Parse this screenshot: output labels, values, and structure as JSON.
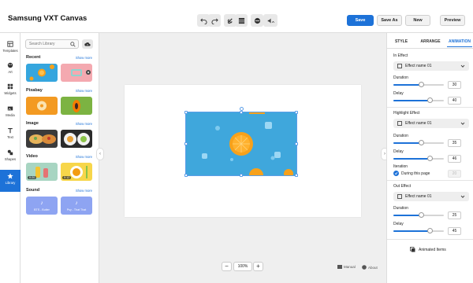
{
  "app": {
    "title": "Samsung VXT Canvas"
  },
  "toolbar": {
    "save": "Save",
    "save_as": "Save As",
    "new": "New",
    "preview": "Preview",
    "icons": [
      "undo-icon",
      "redo-icon",
      "link-icon",
      "grid-icon",
      "layers-icon",
      "volume-icon"
    ]
  },
  "nav": {
    "items": [
      {
        "label": "Templates",
        "icon": "templates-icon"
      },
      {
        "label": "Art",
        "icon": "art-icon"
      },
      {
        "label": "Widgets",
        "icon": "widgets-icon"
      },
      {
        "label": "Media",
        "icon": "media-icon"
      },
      {
        "label": "Text",
        "icon": "text-icon"
      },
      {
        "label": "Shapes",
        "icon": "shapes-icon"
      },
      {
        "label": "Library",
        "icon": "star-icon",
        "active": true
      }
    ]
  },
  "library": {
    "search_placeholder": "Search Library",
    "show_more": "Show more",
    "sections": {
      "recent": "Recent",
      "pixabay": "Pixabay",
      "image": "Image",
      "video": "Video",
      "sound": "Sound"
    },
    "video_badges": [
      "0:20",
      "0:12"
    ],
    "sounds": [
      "BTS - Butter",
      "Psy - That That"
    ]
  },
  "zoom": {
    "value": "100%",
    "minus": "−",
    "plus": "+"
  },
  "footer": {
    "manual": "Manual",
    "about": "About"
  },
  "panel": {
    "tabs": [
      "STYLE",
      "ARRANGE",
      "ANIMATION"
    ],
    "active_tab": "ANIMATION",
    "in_effect": {
      "label": "In Effect",
      "select": "Effect name 01",
      "duration_label": "Duration",
      "duration": "30",
      "duration_pct": 0.55,
      "delay_label": "Delay",
      "delay": "40",
      "delay_pct": 0.72
    },
    "highlight_effect": {
      "label": "Highlight Effect",
      "select": "Effect name 01",
      "duration_label": "Duration",
      "duration": "35",
      "duration_pct": 0.55,
      "delay_label": "Delay",
      "delay": "46",
      "delay_pct": 0.72
    },
    "iteration": {
      "label": "Iteration",
      "checkbox_label": "During this page",
      "value": "20"
    },
    "out_effect": {
      "label": "Out Effect",
      "select": "Effect name 01",
      "duration_label": "Duration",
      "duration": "25",
      "duration_pct": 0.55,
      "delay_label": "Delay",
      "delay": "45",
      "delay_pct": 0.72
    },
    "animated_items": "Animated Items"
  },
  "colors": {
    "accent": "#1d72d8",
    "canvas_bg": "#efefef",
    "sound_card": "#8ea4f2"
  }
}
